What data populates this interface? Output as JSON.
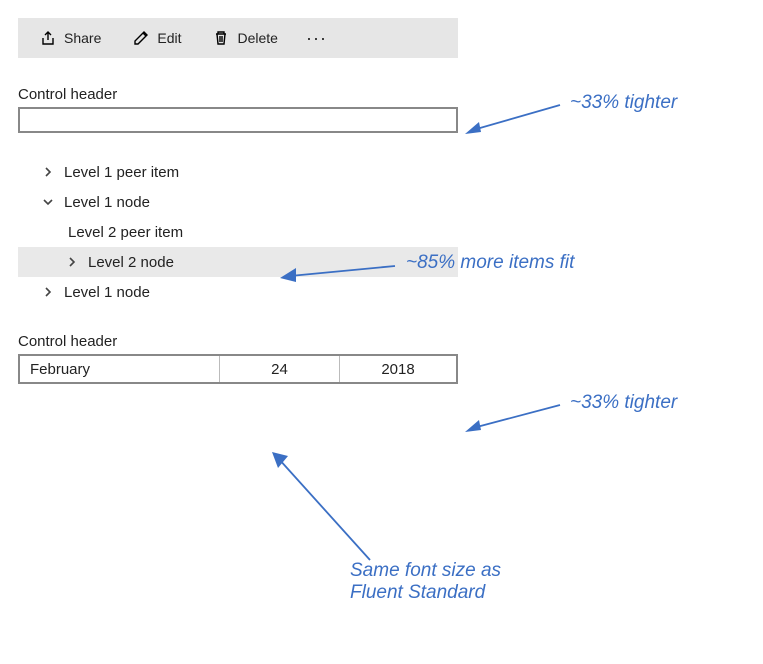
{
  "command_bar": {
    "share_label": "Share",
    "edit_label": "Edit",
    "delete_label": "Delete"
  },
  "control1": {
    "header": "Control header",
    "value": ""
  },
  "tree": {
    "items": [
      {
        "label": "Level 1 peer item",
        "expanded": false,
        "has_children": true,
        "level": 0,
        "selected": false
      },
      {
        "label": "Level 1 node",
        "expanded": true,
        "has_children": true,
        "level": 0,
        "selected": false
      },
      {
        "label": "Level 2 peer item",
        "expanded": false,
        "has_children": false,
        "level": 1,
        "selected": false
      },
      {
        "label": "Level 2 node",
        "expanded": false,
        "has_children": true,
        "level": 1,
        "selected": true
      },
      {
        "label": "Level 1 node",
        "expanded": false,
        "has_children": true,
        "level": 0,
        "selected": false
      }
    ]
  },
  "control2": {
    "header": "Control header",
    "month": "February",
    "day": "24",
    "year": "2018"
  },
  "annotations": {
    "a1": "~33% tighter",
    "a2": "~85% more items fit",
    "a3": "~33% tighter",
    "a4_line1": "Same font size as",
    "a4_line2": "Fluent Standard"
  }
}
